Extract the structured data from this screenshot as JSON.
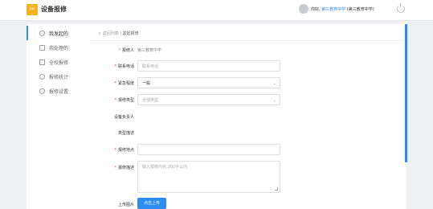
{
  "header": {
    "logo_glyph": "✂",
    "title": "设备报修",
    "greeting": "你好,",
    "school": "第三教育中学",
    "school_note": "(第三教育中学)"
  },
  "sidebar": {
    "items": [
      {
        "label": "我发起的",
        "icon": "user-icon"
      },
      {
        "label": "我处理的",
        "icon": "inbox-icon"
      },
      {
        "label": "全校报修",
        "icon": "school-icon"
      },
      {
        "label": "报修统计",
        "icon": "chart-icon"
      },
      {
        "label": "报修设置",
        "icon": "settings-icon"
      }
    ]
  },
  "breadcrumb": {
    "back": "< 返回列表",
    "sep": "|",
    "current": "发起报修"
  },
  "form": {
    "reporter_label": "报修人",
    "reporter_value": "第三教育中学",
    "phone_label": "联系电话",
    "phone_placeholder": "联系电话",
    "urgency_label": "紧急程度",
    "urgency_value": "一般",
    "type_label": "报修类型",
    "type_value": "全部类型",
    "owner_label": "设备负责人",
    "type_desc_label": "类型描述",
    "location_label": "报修地点",
    "desc_label": "报修描述",
    "desc_placeholder": "输入报修内容,200字以内",
    "upload_label": "上传图片",
    "upload_button": "点击上传"
  },
  "colors": {
    "accent": "#2d8cf0",
    "required": "#ed4014",
    "logo": "#f6b21b"
  }
}
